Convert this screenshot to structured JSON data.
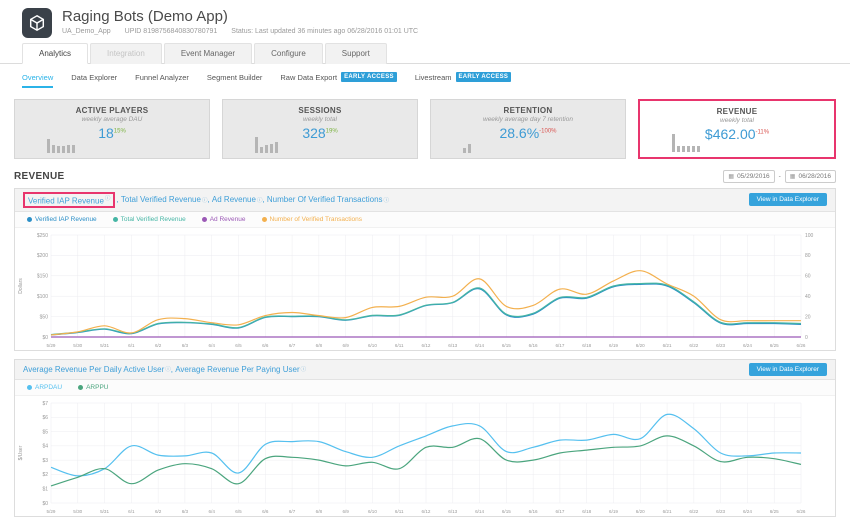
{
  "icons": {
    "info": "ⓘ",
    "calendar": "▦",
    "logo": "unity-cube"
  },
  "header": {
    "app_title": "Raging Bots (Demo App)",
    "app_key": "UA_Demo_App",
    "upid": "UPID 8198756840830780791",
    "status": "Status: Last updated 36 minutes ago 06/28/2016 01:01 UTC"
  },
  "tabs": [
    {
      "label": "Analytics",
      "state": "active"
    },
    {
      "label": "Integration",
      "state": "disabled"
    },
    {
      "label": "Event Manager",
      "state": "normal"
    },
    {
      "label": "Configure",
      "state": "normal"
    },
    {
      "label": "Support",
      "state": "normal"
    }
  ],
  "subnav": [
    {
      "label": "Overview",
      "active": true,
      "badge": ""
    },
    {
      "label": "Data Explorer",
      "active": false,
      "badge": ""
    },
    {
      "label": "Funnel Analyzer",
      "active": false,
      "badge": ""
    },
    {
      "label": "Segment Builder",
      "active": false,
      "badge": ""
    },
    {
      "label": "Raw Data Export",
      "active": false,
      "badge": "EARLY ACCESS"
    },
    {
      "label": "Livestream",
      "active": false,
      "badge": "EARLY ACCESS"
    }
  ],
  "kpis": [
    {
      "title": "ACTIVE PLAYERS",
      "subtitle": "weekly average DAU",
      "value": "18",
      "delta": "15%",
      "delta_color": "#7cb342",
      "bars": [
        14,
        8,
        7,
        7,
        8,
        8
      ]
    },
    {
      "title": "SESSIONS",
      "subtitle": "weekly total",
      "value": "328",
      "delta": "19%",
      "delta_color": "#7cb342",
      "bars": [
        16,
        6,
        8,
        9,
        11
      ]
    },
    {
      "title": "RETENTION",
      "subtitle": "weekly average day 7 retention",
      "value": "28.6%",
      "delta": "-100%",
      "delta_color": "#d9534f",
      "bars": [
        5,
        9
      ]
    },
    {
      "title": "REVENUE",
      "subtitle": "weekly total",
      "value": "$462.00",
      "delta": "-11%",
      "delta_color": "#d9534f",
      "bars": [
        18,
        6,
        6,
        6,
        6,
        6
      ],
      "highlighted": true
    }
  ],
  "section": {
    "title": "REVENUE",
    "date_from": "05/29/2016",
    "date_to": "06/28/2016",
    "date_separator": "-"
  },
  "explore_button": "View in Data Explorer",
  "chart_data": [
    {
      "type": "line",
      "title_links": [
        "Verified IAP Revenue",
        "Total Verified Revenue",
        "Ad Revenue",
        "Number Of Verified Transactions"
      ],
      "highlighted_link": "Verified IAP Revenue",
      "ylabel": "Dollars",
      "ylim": [
        0,
        250
      ],
      "y_tick_step": 50,
      "y_tick_prefix": "$",
      "right_ylim": [
        0,
        100
      ],
      "right_tick_step": 20,
      "grid": true,
      "legend_position": "top",
      "x": [
        "5/29",
        "5/30",
        "5/31",
        "6/1",
        "6/2",
        "6/3",
        "6/4",
        "6/5",
        "6/6",
        "6/7",
        "6/8",
        "6/9",
        "6/10",
        "6/11",
        "6/12",
        "6/13",
        "6/14",
        "6/15",
        "6/16",
        "6/17",
        "6/18",
        "6/19",
        "6/20",
        "6/21",
        "6/22",
        "6/23",
        "6/24",
        "6/25",
        "6/26"
      ],
      "series": [
        {
          "name": "Verified IAP Revenue",
          "color": "#2b8fc7",
          "axis": "left",
          "values": [
            5,
            11,
            19,
            8,
            32,
            35,
            31,
            22,
            48,
            50,
            50,
            41,
            52,
            53,
            77,
            84,
            118,
            54,
            56,
            95,
            95,
            123,
            129,
            125,
            84,
            34,
            33,
            33,
            31
          ]
        },
        {
          "name": "Total Verified Revenue",
          "color": "#45b5a4",
          "axis": "left",
          "values": [
            6,
            12,
            20,
            9,
            33,
            36,
            32,
            23,
            49,
            51,
            51,
            42,
            53,
            54,
            78,
            85,
            120,
            56,
            58,
            97,
            97,
            125,
            131,
            127,
            86,
            36,
            35,
            35,
            33
          ]
        },
        {
          "name": "Ad Revenue",
          "color": "#9b59b6",
          "axis": "left",
          "values": [
            0,
            0,
            0,
            0,
            0,
            0,
            0,
            0,
            0,
            0,
            0,
            0,
            0,
            0,
            0,
            0,
            0,
            0,
            0,
            0,
            0,
            0,
            0,
            0,
            0,
            0,
            0,
            0,
            0
          ]
        },
        {
          "name": "Number of Verified Transactions",
          "color": "#f3b04e",
          "axis": "right",
          "values": [
            2,
            5,
            11,
            4,
            17,
            18,
            14,
            12,
            21,
            24,
            21,
            19,
            29,
            30,
            39,
            40,
            57,
            30,
            31,
            47,
            42,
            55,
            65,
            52,
            40,
            17,
            16,
            16,
            16
          ]
        }
      ]
    },
    {
      "type": "line",
      "title_links": [
        "Average Revenue Per Daily Active User",
        "Average Revenue Per Paying User"
      ],
      "ylabel": "$/User",
      "ylim": [
        0,
        7
      ],
      "y_tick_step": 1,
      "y_tick_prefix": "$",
      "grid": true,
      "legend_position": "top",
      "x": [
        "5/29",
        "5/30",
        "5/31",
        "6/1",
        "6/2",
        "6/3",
        "6/4",
        "6/5",
        "6/6",
        "6/7",
        "6/8",
        "6/9",
        "6/10",
        "6/11",
        "6/12",
        "6/13",
        "6/14",
        "6/15",
        "6/16",
        "6/17",
        "6/18",
        "6/19",
        "6/20",
        "6/21",
        "6/22",
        "6/23",
        "6/24",
        "6/25",
        "6/26"
      ],
      "series": [
        {
          "name": "ARPDAU",
          "color": "#55c0ef",
          "axis": "left",
          "values": [
            2.5,
            1.9,
            2.4,
            4.0,
            3.35,
            3.3,
            3.5,
            2.1,
            4.1,
            4.3,
            4.3,
            3.6,
            3.2,
            4.0,
            4.7,
            5.4,
            5.4,
            3.6,
            3.9,
            4.4,
            4.4,
            4.8,
            4.5,
            6.2,
            5.2,
            3.5,
            3.3,
            3.5,
            3.5
          ]
        },
        {
          "name": "ARPPU",
          "color": "#4ba57e",
          "axis": "left",
          "values": [
            1.2,
            1.8,
            2.4,
            1.35,
            2.3,
            2.75,
            2.4,
            1.35,
            3.1,
            3.2,
            3.0,
            2.6,
            2.85,
            2.4,
            3.9,
            3.9,
            4.5,
            3.0,
            3.0,
            3.5,
            3.7,
            3.9,
            4.0,
            4.7,
            4.0,
            2.9,
            3.2,
            3.1,
            2.7
          ]
        }
      ]
    }
  ]
}
